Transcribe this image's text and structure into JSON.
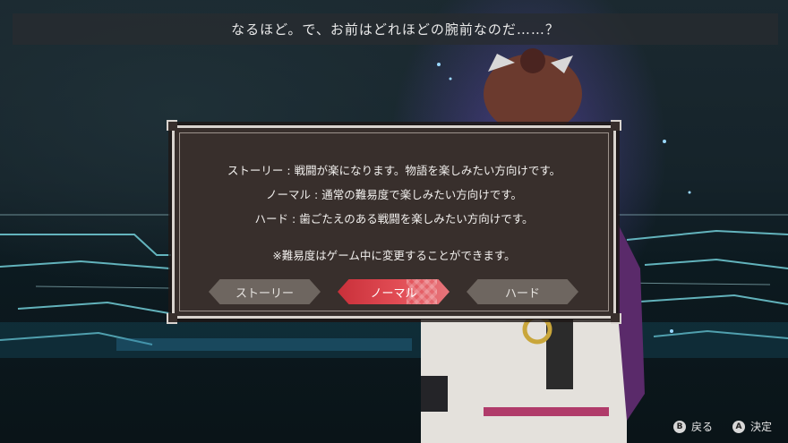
{
  "dialogue": "なるほど。で、お前はどれほどの腕前なのだ……？",
  "modes": [
    {
      "name": "ストーリー",
      "desc": "戦闘が楽になります。物語を楽しみたい方向けです。"
    },
    {
      "name": "ノーマル",
      "desc": "通常の難易度で楽しみたい方向けです。"
    },
    {
      "name": "ハード",
      "desc": "歯ごたえのある戦闘を楽しみたい方向けです。"
    }
  ],
  "note": "※難易度はゲーム中に変更することができます。",
  "buttons": [
    {
      "label": "ストーリー",
      "selected": false
    },
    {
      "label": "ノーマル",
      "selected": true
    },
    {
      "label": "ハード",
      "selected": false
    }
  ],
  "controls": {
    "back_key": "B",
    "back_label": "戻る",
    "confirm_key": "A",
    "confirm_label": "決定"
  },
  "colors": {
    "accent": "#e24d55",
    "panel": "#382f2c",
    "frame": "#d9d4cf"
  }
}
